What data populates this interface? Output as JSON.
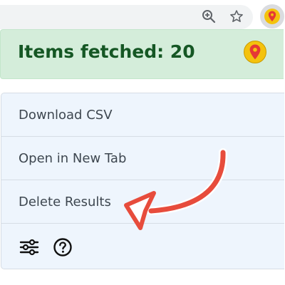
{
  "browser": {
    "icons": {
      "zoom": "zoom-in-icon",
      "bookmark": "star-icon",
      "extension": "map-pin-icon"
    }
  },
  "popup": {
    "status": {
      "text": "Items fetched: 20",
      "logo_icon": "map-pin-icon"
    },
    "menu": {
      "items": [
        {
          "label": "Download CSV"
        },
        {
          "label": "Open in New Tab"
        },
        {
          "label": "Delete Results"
        }
      ],
      "footer_icons": [
        "sliders-icon",
        "help-circle-icon"
      ]
    }
  },
  "colors": {
    "banner_bg": "#d4edda",
    "banner_text": "#155724",
    "menu_bg": "#eef5fd",
    "annotation_arrow": "#e74c3c",
    "logo_outer": "#f4c20d",
    "logo_pin": "#e53935"
  }
}
